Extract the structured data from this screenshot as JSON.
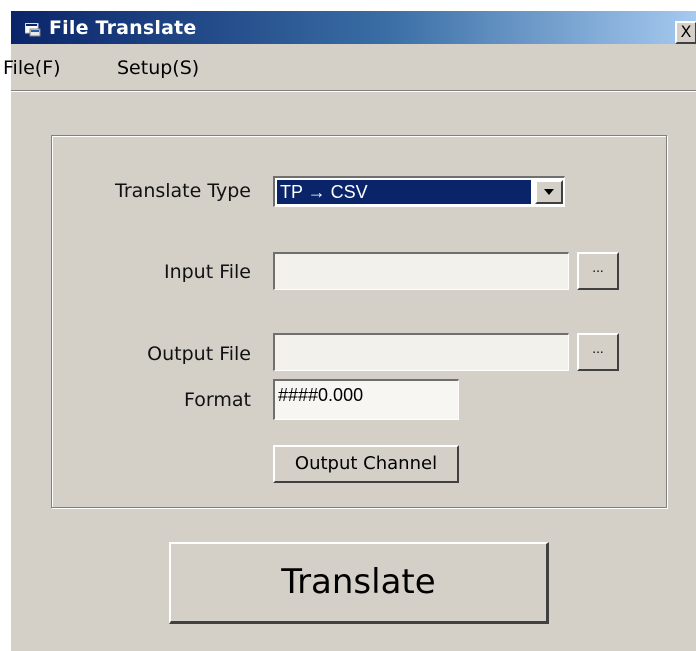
{
  "window": {
    "title": "File Translate",
    "close_label": "X"
  },
  "menu": {
    "file": "File(F)",
    "setup": "Setup(S)"
  },
  "form": {
    "translate_type_label": "Translate Type",
    "translate_type_value": "TP → CSV",
    "input_file_label": "Input File",
    "input_file_value": "",
    "input_browse_label": "...",
    "output_file_label": "Output File",
    "output_file_value": "",
    "output_browse_label": "...",
    "format_label": "Format",
    "format_value": "####0.000",
    "output_channel_label": "Output Channel"
  },
  "actions": {
    "translate_label": "Translate"
  },
  "icons": {
    "app": "app-window-icon",
    "dropdown": "chevron-down-icon"
  }
}
